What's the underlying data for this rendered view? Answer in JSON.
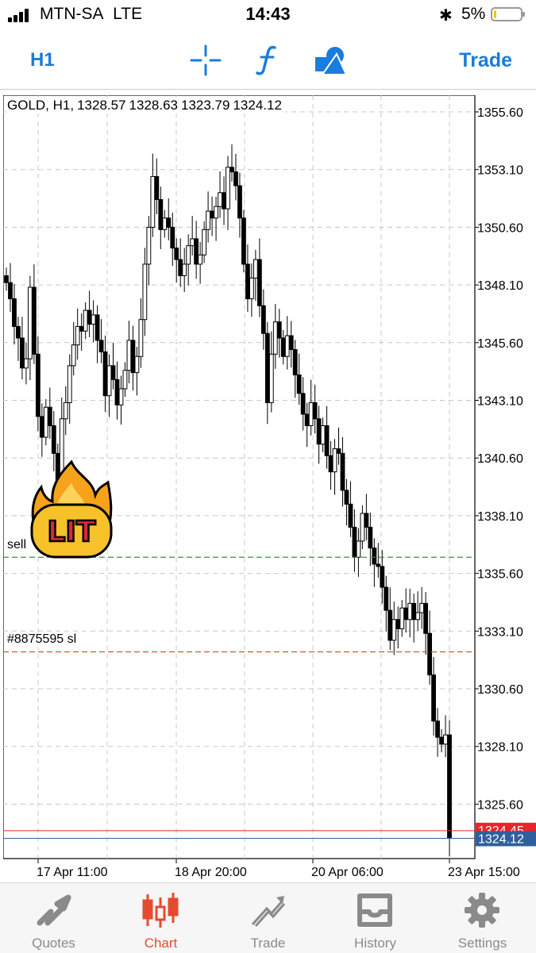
{
  "status_bar": {
    "carrier": "MTN-SA",
    "network": "LTE",
    "time": "14:43",
    "battery": "5%"
  },
  "toolbar": {
    "timeframe": "H1",
    "trade_label": "Trade",
    "icons": [
      "crosshair-icon",
      "function-icon",
      "objects-icon"
    ],
    "accent_color": "#1a7cdc"
  },
  "chart": {
    "symbol_line": [
      "GOLD, H1,",
      "1328.57",
      "1328.63",
      "1323.79",
      "1324.12"
    ],
    "price_axis": [
      "1355.60",
      "1353.10",
      "1350.60",
      "1348.10",
      "1345.60",
      "1343.10",
      "1340.60",
      "1338.10",
      "1335.60",
      "1333.10",
      "1330.60",
      "1328.10",
      "1325.60"
    ],
    "time_axis": [
      "17 Apr 11:00",
      "18 Apr 20:00",
      "20 Apr 06:00",
      "23 Apr 15:00"
    ],
    "lines": {
      "sell_label": "sell",
      "sell_price": 1336.3,
      "sell_color": "#2e9a2e",
      "sl_label": "#8875595 sl",
      "sl_price": 1332.2,
      "sl_color": "#e05030",
      "ask_price_label": "1324.45",
      "ask_price": 1324.45,
      "ask_color": "#e8262a",
      "bid_price_label": "1324.12",
      "bid_price": 1324.12,
      "bid_color": "#2f5f9e"
    },
    "sticker_text": "LIT"
  },
  "chart_data": {
    "type": "candlestick",
    "title": "GOLD, H1, 1328.57 1328.63 1323.79 1324.12",
    "ylim": [
      1324.0,
      1356.0
    ],
    "x_ticks": [
      "17 Apr 11:00",
      "18 Apr 20:00",
      "20 Apr 06:00",
      "23 Apr 15:00"
    ],
    "close_path": [
      1348.2,
      1347.5,
      1346.3,
      1345.8,
      1344.5,
      1344.9,
      1348.0,
      1345.1,
      1342.4,
      1341.5,
      1342.8,
      1342.0,
      1340.8,
      1339.5,
      1342.3,
      1343.0,
      1344.6,
      1345.5,
      1346.3,
      1346.1,
      1347.0,
      1346.4,
      1346.8,
      1345.7,
      1345.2,
      1343.3,
      1344.6,
      1344.0,
      1342.9,
      1343.6,
      1344.4,
      1345.7,
      1344.3,
      1345.0,
      1346.6,
      1349.0,
      1350.6,
      1352.8,
      1351.8,
      1350.5,
      1351.0,
      1350.6,
      1349.7,
      1349.2,
      1348.5,
      1349.0,
      1349.8,
      1350.1,
      1349.0,
      1349.4,
      1350.5,
      1351.3,
      1351.0,
      1351.5,
      1352.1,
      1351.4,
      1353.2,
      1353.0,
      1352.4,
      1351.0,
      1349.0,
      1347.5,
      1348.4,
      1349.2,
      1347.2,
      1346.0,
      1343.0,
      1345.1,
      1346.5,
      1345.8,
      1345.0,
      1345.9,
      1345.3,
      1344.2,
      1343.4,
      1342.5,
      1342.0,
      1343.0,
      1342.3,
      1341.2,
      1342.0,
      1340.7,
      1340.0,
      1341.0,
      1340.8,
      1339.2,
      1338.6,
      1337.6,
      1336.3,
      1337.0,
      1338.2,
      1337.6,
      1336.7,
      1336.0,
      1335.9,
      1335.0,
      1334.0,
      1332.7,
      1333.6,
      1333.2,
      1334.1,
      1333.6,
      1334.3,
      1333.6,
      1333.9,
      1334.3,
      1333.0,
      1331.2,
      1329.2,
      1328.5,
      1328.2,
      1328.6,
      1324.12
    ]
  }
}
